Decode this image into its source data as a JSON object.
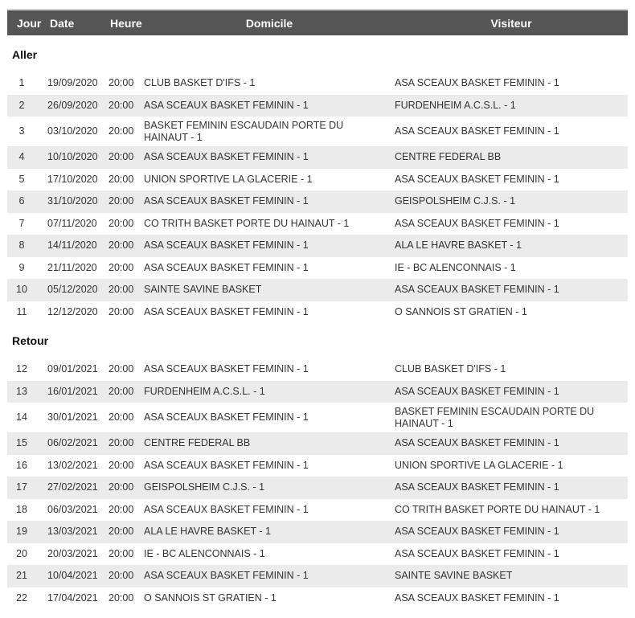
{
  "headers": {
    "jour": "Jour",
    "date": "Date",
    "heure": "Heure",
    "domicile": "Domicile",
    "visiteur": "Visiteur"
  },
  "sections": [
    {
      "title": "Aller",
      "rows": [
        {
          "jour": "1",
          "date": "19/09/2020",
          "heure": "20:00",
          "domicile": "CLUB BASKET D'IFS - 1",
          "visiteur": "ASA SCEAUX BASKET FEMININ - 1"
        },
        {
          "jour": "2",
          "date": "26/09/2020",
          "heure": "20:00",
          "domicile": "ASA SCEAUX BASKET FEMININ - 1",
          "visiteur": "FURDENHEIM A.C.S.L. - 1"
        },
        {
          "jour": "3",
          "date": "03/10/2020",
          "heure": "20:00",
          "domicile": "BASKET FEMININ ESCAUDAIN PORTE DU HAINAUT - 1",
          "visiteur": "ASA SCEAUX BASKET FEMININ - 1"
        },
        {
          "jour": "4",
          "date": "10/10/2020",
          "heure": "20:00",
          "domicile": "ASA SCEAUX BASKET FEMININ - 1",
          "visiteur": "CENTRE FEDERAL BB"
        },
        {
          "jour": "5",
          "date": "17/10/2020",
          "heure": "20:00",
          "domicile": "UNION SPORTIVE LA GLACERIE - 1",
          "visiteur": "ASA SCEAUX BASKET FEMININ - 1"
        },
        {
          "jour": "6",
          "date": "31/10/2020",
          "heure": "20:00",
          "domicile": "ASA SCEAUX BASKET FEMININ - 1",
          "visiteur": "GEISPOLSHEIM C.J.S. - 1"
        },
        {
          "jour": "7",
          "date": "07/11/2020",
          "heure": "20:00",
          "domicile": "CO TRITH BASKET PORTE DU HAINAUT - 1",
          "visiteur": "ASA SCEAUX BASKET FEMININ - 1"
        },
        {
          "jour": "8",
          "date": "14/11/2020",
          "heure": "20:00",
          "domicile": "ASA SCEAUX BASKET FEMININ - 1",
          "visiteur": "ALA LE HAVRE BASKET - 1"
        },
        {
          "jour": "9",
          "date": "21/11/2020",
          "heure": "20:00",
          "domicile": "ASA SCEAUX BASKET FEMININ - 1",
          "visiteur": "IE - BC ALENCONNAIS - 1"
        },
        {
          "jour": "10",
          "date": "05/12/2020",
          "heure": "20:00",
          "domicile": "SAINTE SAVINE BASKET",
          "visiteur": "ASA SCEAUX BASKET FEMININ - 1"
        },
        {
          "jour": "11",
          "date": "12/12/2020",
          "heure": "20:00",
          "domicile": "ASA SCEAUX BASKET FEMININ - 1",
          "visiteur": "O SANNOIS ST GRATIEN - 1"
        }
      ]
    },
    {
      "title": "Retour",
      "rows": [
        {
          "jour": "12",
          "date": "09/01/2021",
          "heure": "20:00",
          "domicile": "ASA SCEAUX BASKET FEMININ - 1",
          "visiteur": "CLUB BASKET D'IFS - 1"
        },
        {
          "jour": "13",
          "date": "16/01/2021",
          "heure": "20:00",
          "domicile": "FURDENHEIM A.C.S.L. - 1",
          "visiteur": "ASA SCEAUX BASKET FEMININ - 1"
        },
        {
          "jour": "14",
          "date": "30/01/2021",
          "heure": "20:00",
          "domicile": "ASA SCEAUX BASKET FEMININ - 1",
          "visiteur": "BASKET FEMININ ESCAUDAIN PORTE DU HAINAUT - 1"
        },
        {
          "jour": "15",
          "date": "06/02/2021",
          "heure": "20:00",
          "domicile": "CENTRE FEDERAL BB",
          "visiteur": "ASA SCEAUX BASKET FEMININ - 1"
        },
        {
          "jour": "16",
          "date": "13/02/2021",
          "heure": "20:00",
          "domicile": "ASA SCEAUX BASKET FEMININ - 1",
          "visiteur": "UNION SPORTIVE LA GLACERIE - 1"
        },
        {
          "jour": "17",
          "date": "27/02/2021",
          "heure": "20:00",
          "domicile": "GEISPOLSHEIM C.J.S. - 1",
          "visiteur": "ASA SCEAUX BASKET FEMININ - 1"
        },
        {
          "jour": "18",
          "date": "06/03/2021",
          "heure": "20:00",
          "domicile": "ASA SCEAUX BASKET FEMININ - 1",
          "visiteur": "CO TRITH BASKET PORTE DU HAINAUT - 1"
        },
        {
          "jour": "19",
          "date": "13/03/2021",
          "heure": "20:00",
          "domicile": "ALA LE HAVRE BASKET - 1",
          "visiteur": "ASA SCEAUX BASKET FEMININ - 1"
        },
        {
          "jour": "20",
          "date": "20/03/2021",
          "heure": "20:00",
          "domicile": "IE - BC ALENCONNAIS - 1",
          "visiteur": "ASA SCEAUX BASKET FEMININ - 1"
        },
        {
          "jour": "21",
          "date": "10/04/2021",
          "heure": "20:00",
          "domicile": "ASA SCEAUX BASKET FEMININ - 1",
          "visiteur": "SAINTE SAVINE BASKET"
        },
        {
          "jour": "22",
          "date": "17/04/2021",
          "heure": "20:00",
          "domicile": "O SANNOIS ST GRATIEN - 1",
          "visiteur": "ASA SCEAUX BASKET FEMININ - 1"
        }
      ]
    }
  ],
  "colors": {
    "header_bg": "#555555",
    "header_text": "#ffffff",
    "stripe_bg": "#ebebeb",
    "text": "#333333"
  }
}
